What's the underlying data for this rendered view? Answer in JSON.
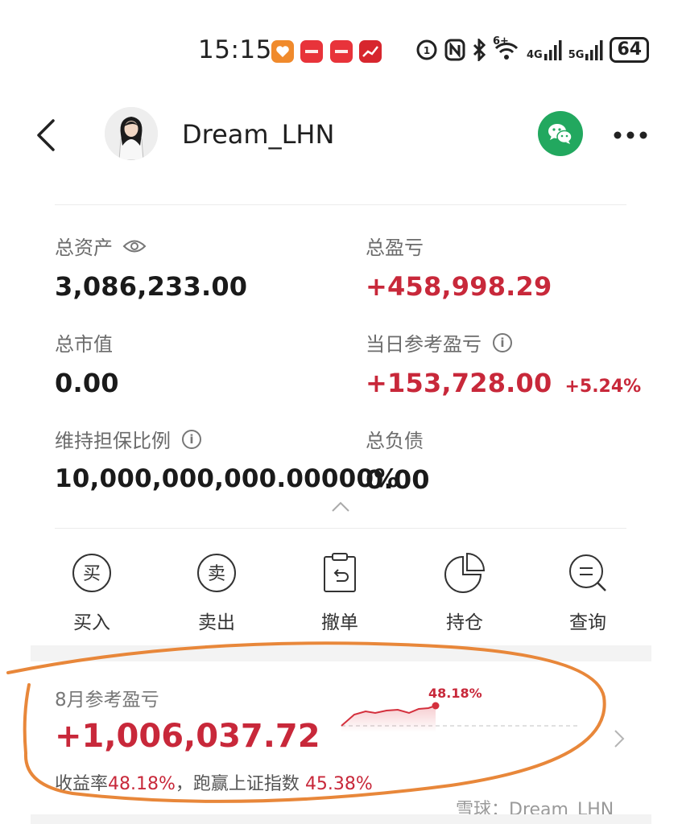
{
  "status_bar": {
    "time": "15:15",
    "battery": "64",
    "network_4g": "4G",
    "network_5g": "5G",
    "wifi_badge": "6+",
    "icons": [
      "nfc-icon",
      "bluetooth-icon",
      "wifi-icon",
      "signal-icon",
      "battery-icon"
    ]
  },
  "header": {
    "username": "Dream_LHN",
    "icons": [
      "back-arrow-icon",
      "wechat-icon",
      "more-dots-icon"
    ]
  },
  "metrics": {
    "total_assets": {
      "label": "总资产",
      "value": "3,086,233.00"
    },
    "total_pnl": {
      "label": "总盈亏",
      "value": "+458,998.29"
    },
    "market_value": {
      "label": "总市值",
      "value": "0.00"
    },
    "daily_pnl": {
      "label": "当日参考盈亏",
      "value": "+153,728.00",
      "pct": "+5.24%"
    },
    "margin_ratio": {
      "label": "维持担保比例",
      "value": "10,000,000,000.00000%"
    },
    "total_liabilities": {
      "label": "总负债",
      "value": "0.00"
    }
  },
  "actions": [
    {
      "label": "买入",
      "glyph": "买",
      "icon": "buy-icon"
    },
    {
      "label": "卖出",
      "glyph": "卖",
      "icon": "sell-icon"
    },
    {
      "label": "撤单",
      "icon": "cancel-order-icon"
    },
    {
      "label": "持仓",
      "icon": "pie-chart-icon"
    },
    {
      "label": "查询",
      "icon": "search-icon"
    }
  ],
  "monthly": {
    "label": "8月参考盈亏",
    "value": "+1,006,037.72",
    "rate_label": "收益率",
    "rate_value": "48.18%",
    "sep": "，",
    "beat_label": "跑赢上证指数",
    "beat_value": "45.38%",
    "spark_label": "48.18%"
  },
  "watermark": "雪球：Dream_LHN",
  "colors": {
    "accent_red": "#c8283a",
    "wechat_green": "#22a85f",
    "highlight_orange": "#e8873a"
  }
}
